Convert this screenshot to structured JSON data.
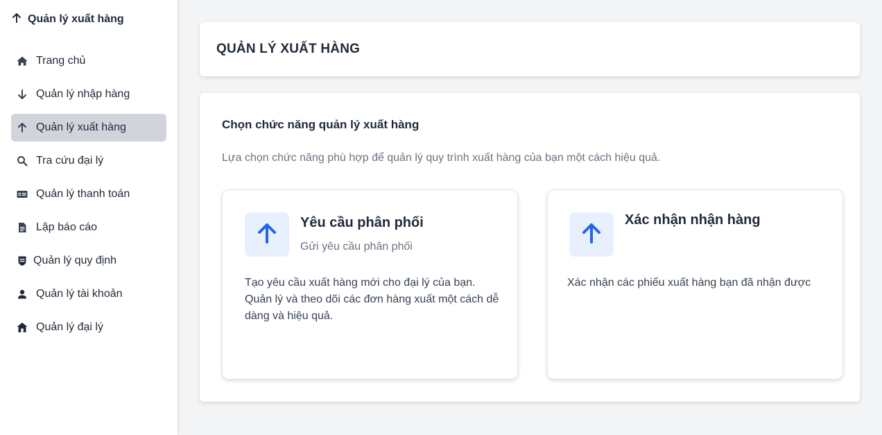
{
  "sidebar": {
    "brand": "Quản lý xuất hàng",
    "items": [
      {
        "label": "Trang chủ",
        "icon": "home-icon",
        "active": false
      },
      {
        "label": "Quản lý nhập hàng",
        "icon": "arrow-down-icon",
        "active": false
      },
      {
        "label": "Quản lý xuất hàng",
        "icon": "arrow-up-icon",
        "active": true
      },
      {
        "label": "Tra cứu đại lý",
        "icon": "search-icon",
        "active": false
      },
      {
        "label": "Quản lý thanh toán",
        "icon": "payment-card-icon",
        "active": false
      },
      {
        "label": "Lập báo cáo",
        "icon": "document-icon",
        "active": false
      },
      {
        "label": "Quản lý quy định",
        "icon": "shield-icon",
        "active": false
      },
      {
        "label": "Quản lý tài khoản",
        "icon": "user-icon",
        "active": false
      },
      {
        "label": "Quản lý đại lý",
        "icon": "store-icon",
        "active": false
      }
    ]
  },
  "header": {
    "title": "QUẢN LÝ XUẤT HÀNG"
  },
  "main": {
    "title": "Chọn chức năng quản lý xuất hàng",
    "description": "Lựa chọn chức năng phù hợp để quản lý quy trình xuất hàng của bạn một cách hiệu quả.",
    "cards": [
      {
        "title": "Yêu cầu phân phối",
        "subtitle": "Gửi yêu cầu phân phối",
        "description": "Tạo yêu cầu xuất hàng mới cho đại lý của bạn. Quản lý và theo dõi các đơn hàng xuất một cách dễ dàng và hiệu quả.",
        "icon": "arrow-up-icon"
      },
      {
        "title": "Xác nhận nhận hàng",
        "description": "Xác nhận các phiếu xuất hàng bạn đã nhận được",
        "icon": "arrow-up-icon"
      }
    ]
  },
  "colors": {
    "accent": "#2563eb",
    "icon_bg": "#e8f0fd",
    "active_bg": "#d1d5db",
    "page_bg": "#f3f4f6"
  }
}
